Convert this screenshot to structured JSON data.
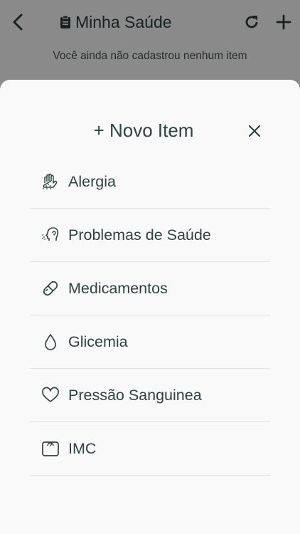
{
  "app_bar": {
    "title": "Minha Saúde",
    "back_icon": "chevron-left-icon",
    "title_icon": "clipboard-icon",
    "refresh_icon": "refresh-icon",
    "add_icon": "plus-icon"
  },
  "main": {
    "empty_message": "Você ainda não cadastrou nenhum item"
  },
  "sheet": {
    "title": "+ Novo Item",
    "close_icon": "close-icon",
    "items": [
      {
        "label": "Alergia",
        "icon": "hand-icon"
      },
      {
        "label": "Problemas de Saúde",
        "icon": "sneeze-icon"
      },
      {
        "label": "Medicamentos",
        "icon": "pill-icon"
      },
      {
        "label": "Glicemia",
        "icon": "drop-icon"
      },
      {
        "label": "Pressão Sanguinea",
        "icon": "heart-icon"
      },
      {
        "label": "IMC",
        "icon": "scale-icon"
      }
    ]
  },
  "colors": {
    "text": "#2f4244",
    "overlay": "rgba(0,0,0,0.46)",
    "sheet_background": "#f9f9f9",
    "divider": "#e2e2e2"
  }
}
